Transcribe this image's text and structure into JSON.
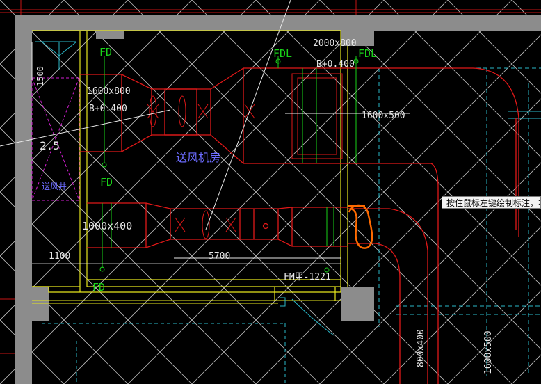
{
  "labels": {
    "fd_top": "FD",
    "fdl_left": "FDL",
    "fdl_right": "FDL",
    "dim_1500": "1500",
    "duct_2000x800": "2000x800",
    "elev_b400_top": "B+0.400",
    "duct_1600x800": "1600x800",
    "elev_b400_left": "B+0.400",
    "duct_1600x500": "1600x500",
    "num_25": "2.5",
    "room_supply_fan": "送风机房",
    "shaft_supply": "送风井",
    "fd_mid": "FD",
    "duct_1000x400": "1000x400",
    "dim_1100": "1100",
    "dim_5700": "5700",
    "door_fm": "FM甲-1221",
    "fd_bottom": "FD",
    "duct_800x400": "800x400",
    "duct_1600x500_v": "1600x500"
  },
  "tooltip": {
    "text": "按住鼠标左键绘制标注，右"
  },
  "colors": {
    "background": "#000000",
    "wall": "#8c8c8c",
    "inner_wall": "#e6e61e",
    "duct": "#e01818",
    "white_line": "#e8e8e8",
    "green": "#19d219",
    "cyan": "#2ab7c8",
    "blue_label": "#6c6cff",
    "magenta": "#d21ed2",
    "orange_mark": "#ff6a00"
  }
}
